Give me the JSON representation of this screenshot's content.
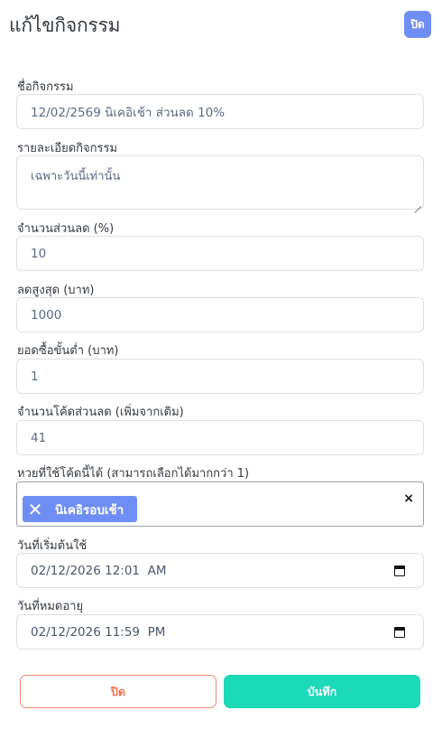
{
  "modal": {
    "title": "แก้ไขกิจกรรม",
    "close_badge": "ปิด"
  },
  "form": {
    "activity_name": {
      "label": "ชื่อกิจกรรม",
      "value": "12/02/2569 นิเคอิเช้า ส่วนลด 10%"
    },
    "activity_detail": {
      "label": "รายละเอียดกิจกรรม",
      "value": "เฉพาะวันนี้เท่านั้น"
    },
    "discount_percent": {
      "label": "จำนวนส่วนลด (%)",
      "value": "10"
    },
    "max_discount": {
      "label": "ลดสูงสุด (บาท)",
      "value": "1000"
    },
    "min_purchase": {
      "label": "ยอดซื้อขั้นต่ำ (บาท)",
      "value": "1"
    },
    "code_count": {
      "label": "จำนวนโค้ดส่วนลด (เพิ่มจากเดิม)",
      "value": "41"
    },
    "lottery_select": {
      "label": "หวยที่ใช้โค้ดนี้ได้ (สามารถเลือกได้มากกว่า 1)",
      "selected": [
        "นิเคอิรอบเช้า"
      ],
      "clear_glyph": "×",
      "chip_remove_glyph": "✕"
    },
    "start_date": {
      "label": "วันที่เริ่มต้นใช้",
      "value": "02/12/2026 12:01  AM"
    },
    "expire_date": {
      "label": "วันที่หมดอายุ",
      "value": "02/12/2026 11:59  PM"
    }
  },
  "footer": {
    "close_label": "ปิด",
    "save_label": "บันทึก"
  },
  "colors": {
    "accent_blue": "#6f8ef5",
    "save_teal": "#1cd9b7",
    "close_orange": "#f07052"
  }
}
